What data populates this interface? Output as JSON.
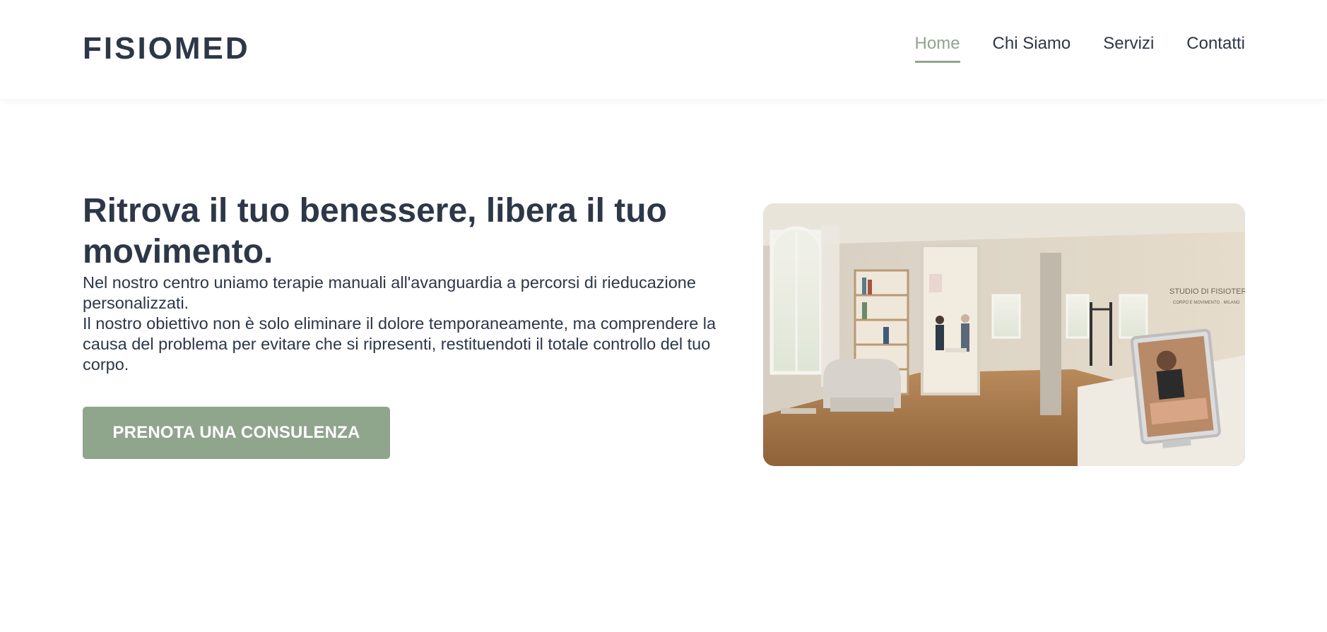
{
  "header": {
    "logo": "FISIOMED",
    "nav": [
      {
        "label": "Home",
        "active": true
      },
      {
        "label": "Chi Siamo",
        "active": false
      },
      {
        "label": "Servizi",
        "active": false
      },
      {
        "label": "Contatti",
        "active": false
      }
    ]
  },
  "hero": {
    "title": "Ritrova il tuo benessere, libera il tuo movimento.",
    "paragraph_1": "Nel nostro centro uniamo terapie manuali all'avanguardia a percorsi di rieducazione personalizzati.",
    "paragraph_2": "Il nostro obiettivo non è solo eliminare il dolore temporaneamente, ma comprendere la causa del problema per evitare che si ripresenti, restituendoti il totale controllo del tuo corpo.",
    "cta_label": "PRENOTA UNA CONSULENZA",
    "image": {
      "wall_sign": "STUDIO DI FISIOTERAPIA",
      "wall_sign_sub": "CORPO E MOVIMENTO · MILANO"
    }
  },
  "colors": {
    "accent": "#8fa58c",
    "text": "#2d3748",
    "background": "#ffffff"
  }
}
